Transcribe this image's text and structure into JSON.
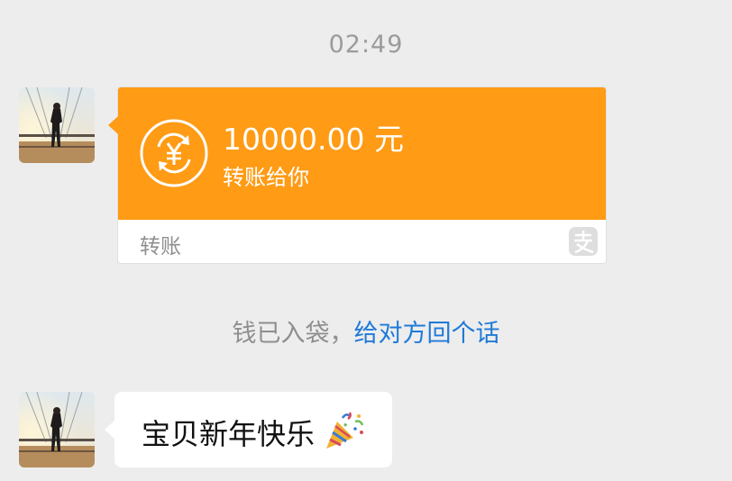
{
  "chat": {
    "timestamp": "02:49",
    "transfer": {
      "amount": "10000.00 元",
      "description": "转账给你",
      "type_label": "转账",
      "icon": "yuan-transfer-icon",
      "badge_icon": "alipay-icon",
      "accent_color": "#ff9b14"
    },
    "system_message": {
      "text": "钱已入袋，",
      "link": "给对方回个话",
      "link_color": "#1f7ad8"
    },
    "message": {
      "text": "宝贝新年快乐",
      "emoji_icon": "party-popper-icon"
    },
    "avatar_icon": "contact-avatar"
  }
}
